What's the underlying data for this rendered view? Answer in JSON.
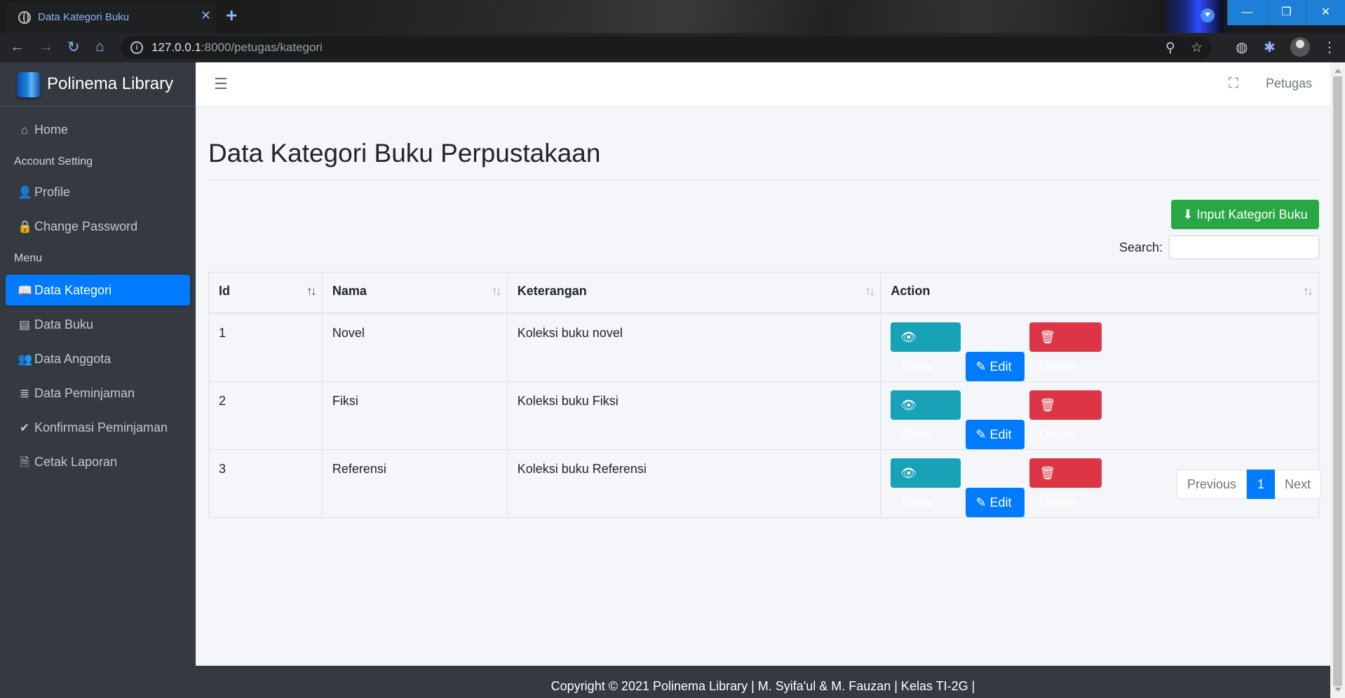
{
  "browser": {
    "tab_title": "Data Kategori Buku",
    "url_host": "127.0.0.1",
    "url_path": ":8000/petugas/kategori"
  },
  "sidebar": {
    "brand": "Polinema Library",
    "home": "Home",
    "account_header": "Account Setting",
    "profile": "Profile",
    "change_password": "Change Password",
    "menu_header": "Menu",
    "items": [
      {
        "label": "Data Kategori",
        "icon": "book-open-icon",
        "active": true
      },
      {
        "label": "Data Buku",
        "icon": "book-icon",
        "active": false
      },
      {
        "label": "Data Anggota",
        "icon": "users-icon",
        "active": false
      },
      {
        "label": "Data Peminjaman",
        "icon": "database-icon",
        "active": false
      },
      {
        "label": "Konfirmasi Peminjaman",
        "icon": "check-circle-icon",
        "active": false
      },
      {
        "label": "Cetak Laporan",
        "icon": "pdf-file-icon",
        "active": false
      }
    ]
  },
  "navbar": {
    "user": "Petugas"
  },
  "main": {
    "title": "Data Kategori Buku Perpustakaan",
    "add_button": "Input Kategori Buku",
    "search_label": "Search:",
    "search_value": ""
  },
  "table": {
    "columns": [
      "Id",
      "Nama",
      "Keterangan",
      "Action"
    ],
    "rows": [
      {
        "id": "1",
        "nama": "Novel",
        "keterangan": "Koleksi buku novel"
      },
      {
        "id": "2",
        "nama": "Fiksi",
        "keterangan": "Koleksi buku Fiksi"
      },
      {
        "id": "3",
        "nama": "Referensi",
        "keterangan": "Koleksi buku Referensi"
      }
    ],
    "actions": {
      "show": "Show",
      "edit": "Edit",
      "delete": "Delete"
    }
  },
  "pagination": {
    "previous": "Previous",
    "current": "1",
    "next": "Next"
  },
  "footer": {
    "text": "Copyright © 2021 Polinema Library | M. Syifa'ul & M. Fauzan | Kelas TI-2G |"
  },
  "colors": {
    "primary": "#007bff",
    "success": "#28a745",
    "info": "#17a2b8",
    "danger": "#dc3545",
    "sidebar": "#343a40"
  }
}
